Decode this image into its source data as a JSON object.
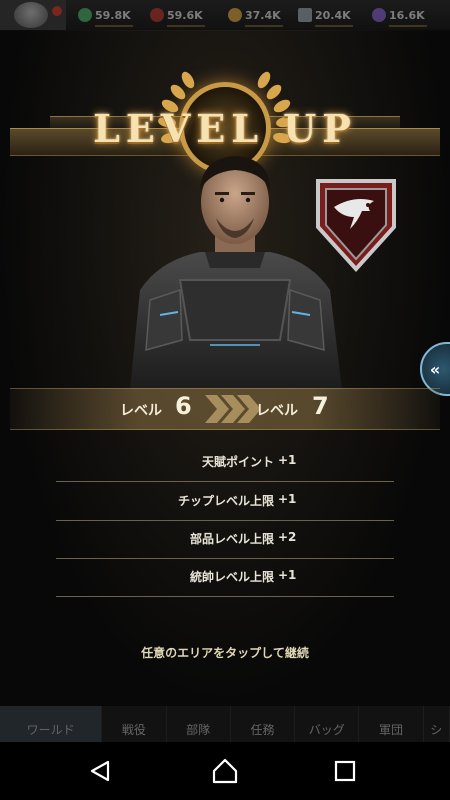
{
  "resources": [
    {
      "name": "gem",
      "icon": "green-crystal-icon",
      "color": "#4caf6a",
      "value": "59.8K"
    },
    {
      "name": "meat",
      "icon": "red-meat-icon",
      "color": "#b33a2e",
      "value": "59.6K"
    },
    {
      "name": "oil",
      "icon": "gold-drop-icon",
      "color": "#d9a441",
      "value": "37.4K"
    },
    {
      "name": "steel",
      "icon": "steel-ingot-icon",
      "color": "#9aa3ad",
      "value": "20.4K"
    },
    {
      "name": "alloy",
      "icon": "purple-cluster-icon",
      "color": "#8a63c9",
      "value": "16.6K"
    }
  ],
  "level_up": {
    "title": "LEVEL UP",
    "level_label": "レベル",
    "from_level": "6",
    "to_level": "7",
    "stats": [
      {
        "name": "天賦ポイント",
        "value": "+1"
      },
      {
        "name": "チップレベル上限",
        "value": "+1"
      },
      {
        "name": "部品レベル上限",
        "value": "+2"
      },
      {
        "name": "統帥レベル上限",
        "value": "+1"
      }
    ],
    "continue_hint": "任意のエリアをタップして継続"
  },
  "side_tab": {
    "label": "«"
  },
  "bottom_nav": {
    "items": [
      "ワールド",
      "戦役",
      "部隊",
      "任務",
      "バッグ",
      "軍団",
      "シ"
    ]
  },
  "colors": {
    "accent_gold": "#c99a45",
    "title_text": "#f6e1b0",
    "stat_text": "#e8e4d8",
    "side_tab": "#2c5870"
  }
}
